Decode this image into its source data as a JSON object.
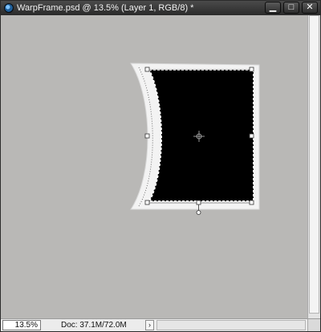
{
  "window": {
    "title": "WarpFrame.psd @ 13.5% (Layer 1, RGB/8) *",
    "app_icon": "photoshop-document-icon",
    "controls": {
      "minimize_icon": "minimize-icon",
      "maximize_icon": "maximize-icon",
      "close_icon": "close-icon"
    }
  },
  "statusbar": {
    "zoom": "13.5%",
    "doc_info": "Doc: 37.1M/72.0M",
    "menu_arrow": "›"
  },
  "canvas": {
    "background_color": "#b9b8b6",
    "layer_fill_color": "#000000",
    "frame_color": "#f3f3f3",
    "transform_state": "warp"
  },
  "colors": {
    "titlebar": "#2f2f2f",
    "title_text": "#f2f2f2"
  }
}
